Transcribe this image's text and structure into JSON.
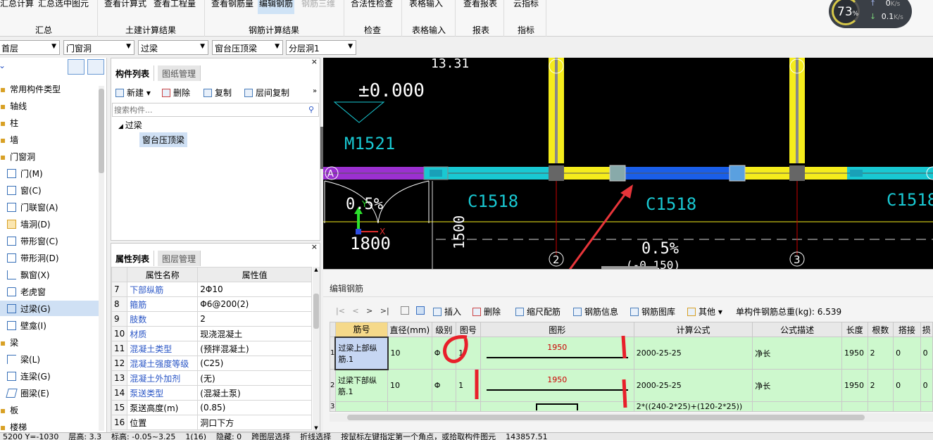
{
  "ribbon": {
    "buttons": [
      "汇总计算",
      "汇总选中图元",
      "查看计算式",
      "查看工程量",
      "查看钢筋量",
      "编辑钢筋",
      "钢筋三维",
      "合法性检查",
      "表格输入",
      "查看报表",
      "云指标"
    ],
    "groups": [
      "汇总",
      "土建计算结果",
      "钢筋计算结果",
      "检查",
      "表格输入",
      "报表",
      "指标"
    ]
  },
  "speed": {
    "percent": "73",
    "pct_unit": "%",
    "up": "0",
    "up_unit": "K/s",
    "down": "0.1",
    "down_unit": "K/s"
  },
  "filters": [
    "首层",
    "门窗洞",
    "过梁",
    "窗台压顶梁",
    "分层洞1"
  ],
  "tree": {
    "items": [
      "常用构件类型",
      "轴线",
      "柱",
      "墙",
      "门窗洞",
      "门(M)",
      "窗(C)",
      "门联窗(A)",
      "墙洞(D)",
      "带形窗(C)",
      "带形洞(D)",
      "飘窗(X)",
      "老虎窗",
      "过梁(G)",
      "壁龛(I)",
      "梁",
      "梁(L)",
      "连梁(G)",
      "圈梁(E)",
      "板",
      "楼梯"
    ]
  },
  "component": {
    "tabs": [
      "构件列表",
      "图纸管理"
    ],
    "tools": [
      "新建",
      "删除",
      "复制",
      "层间复制"
    ],
    "search_placeholder": "搜索构件...",
    "node": "过梁",
    "child": "窗台压顶梁"
  },
  "props": {
    "tabs": [
      "属性列表",
      "图层管理"
    ],
    "headers": [
      "属性名称",
      "属性值"
    ],
    "rows": [
      {
        "n": "7",
        "name": "下部纵筋",
        "value": "2Φ10",
        "blue": true
      },
      {
        "n": "8",
        "name": "箍筋",
        "value": "Φ6@200(2)",
        "blue": true
      },
      {
        "n": "9",
        "name": "肢数",
        "value": "2",
        "blue": true
      },
      {
        "n": "10",
        "name": "材质",
        "value": "现浇混凝土",
        "blue": true
      },
      {
        "n": "11",
        "name": "混凝土类型",
        "value": "(预拌混凝土)",
        "blue": true
      },
      {
        "n": "12",
        "name": "混凝土强度等级",
        "value": "(C25)",
        "blue": true
      },
      {
        "n": "13",
        "name": "混凝土外加剂",
        "value": "(无)",
        "blue": true
      },
      {
        "n": "14",
        "name": "泵送类型",
        "value": "(混凝土泵)",
        "blue": true
      },
      {
        "n": "15",
        "name": "泵送高度(m)",
        "value": "(0.85)",
        "blue": false
      },
      {
        "n": "16",
        "name": "位置",
        "value": "洞口下方",
        "blue": false
      }
    ]
  },
  "cad": {
    "labels": [
      "13.31",
      "±0.000",
      "M1521",
      "C1518",
      "C1518",
      "C1518",
      "0.5%",
      "0.5%",
      "1800",
      "1500",
      "A",
      "2",
      "3",
      "X",
      "Y",
      "(-0.150)"
    ]
  },
  "rebar": {
    "title": "编辑钢筋",
    "tools": [
      "插入",
      "删除",
      "缩尺配筋",
      "钢筋信息",
      "钢筋图库",
      "其他"
    ],
    "total_label": "单构件钢筋总重(kg): 6.539",
    "headers": [
      "筋号",
      "直径(mm)",
      "级别",
      "图号",
      "图形",
      "计算公式",
      "公式描述",
      "长度",
      "根数",
      "搭接",
      "损"
    ],
    "rows": [
      {
        "idx": "1",
        "name": "过梁上部纵筋.1",
        "dia": "10",
        "grade": "Φ",
        "fig": "1",
        "shape": "1950",
        "formula": "2000-25-25",
        "desc": "净长",
        "len": "1950",
        "count": "2",
        "lap": "0",
        "loss": "0"
      },
      {
        "idx": "2",
        "name": "过梁下部纵筋.1",
        "dia": "10",
        "grade": "Φ",
        "fig": "1",
        "shape": "1950",
        "formula": "2000-25-25",
        "desc": "净长",
        "len": "1950",
        "count": "2",
        "lap": "0",
        "loss": "0"
      },
      {
        "idx": "3",
        "name": "",
        "dia": "",
        "grade": "",
        "fig": "",
        "shape": "",
        "formula": "2*((240-2*25)+(120-2*25))",
        "desc": "",
        "len": "",
        "count": "",
        "lap": "",
        "loss": ""
      }
    ]
  },
  "status": {
    "text": "5200 Y=-1030    层高: 3.3    标高: -0.05~3.25    1(16)    隐藏: 0    跨图层选择    折线选择    按鼠标左键指定第一个角点，或拾取构件图元    143857.51"
  }
}
